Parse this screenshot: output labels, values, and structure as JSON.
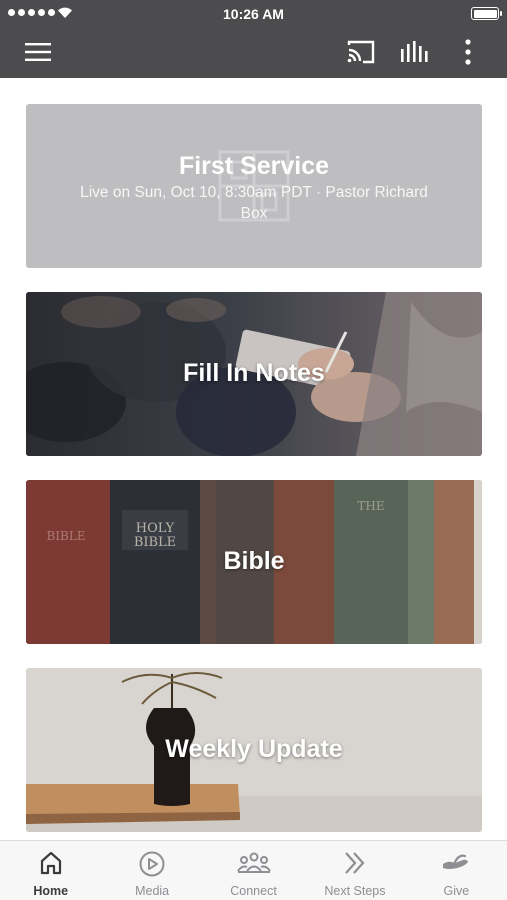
{
  "status_bar": {
    "time": "10:26 AM"
  },
  "app_bar": {
    "icons": [
      "menu-icon",
      "cast-icon",
      "audio-icon",
      "more-icon"
    ]
  },
  "cards": [
    {
      "title": "First Service",
      "subtitle": "Live on Sun, Oct 10, 8:30am PDT · Pastor Richard Box"
    },
    {
      "title": "Fill In Notes"
    },
    {
      "title": "Bible"
    },
    {
      "title": "Weekly Update"
    }
  ],
  "tab_bar": {
    "tabs": [
      {
        "label": "Home",
        "icon": "home-icon",
        "active": true
      },
      {
        "label": "Media",
        "icon": "play-circle-icon",
        "active": false
      },
      {
        "label": "Connect",
        "icon": "people-icon",
        "active": false
      },
      {
        "label": "Next Steps",
        "icon": "double-chevron-icon",
        "active": false
      },
      {
        "label": "Give",
        "icon": "giving-hand-icon",
        "active": false
      }
    ]
  },
  "colors": {
    "app_bar": "#4c4c4e",
    "tab_active": "#3b3b3d",
    "tab_inactive": "#8e8e93"
  }
}
